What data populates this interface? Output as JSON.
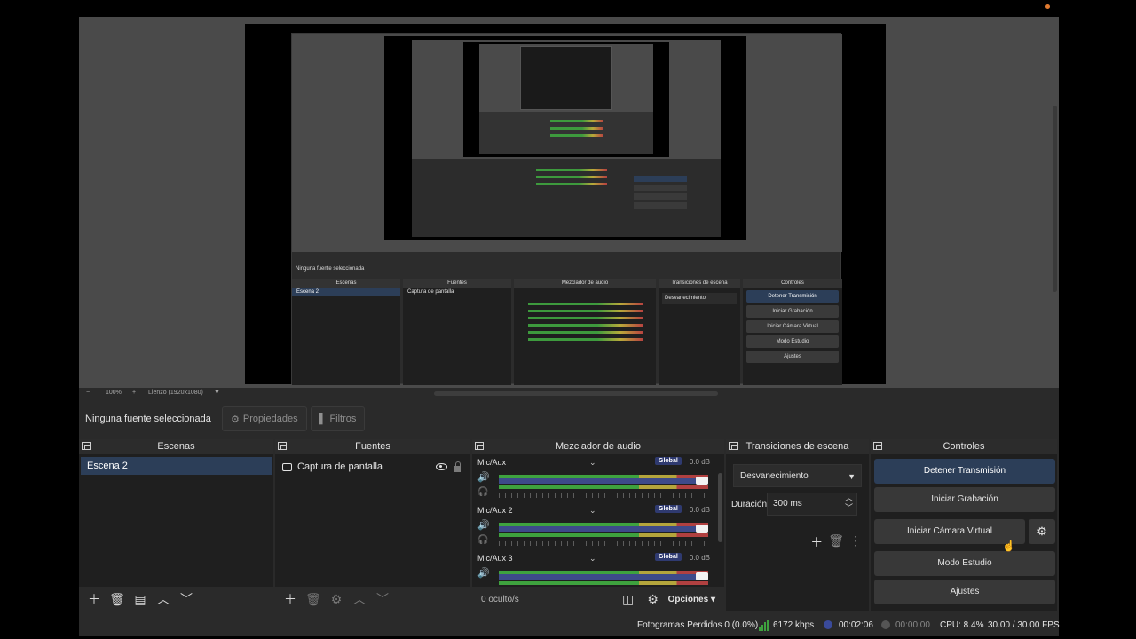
{
  "source_bar": {
    "no_source": "Ninguna fuente seleccionada",
    "properties": "Propiedades",
    "filters": "Filtros"
  },
  "zoom": {
    "minus": "−",
    "level": "100%",
    "plus": "+",
    "canvas": "Lienzo (1920x1080)"
  },
  "docks": {
    "scenes": {
      "title": "Escenas",
      "items": [
        "Escena 2"
      ]
    },
    "sources": {
      "title": "Fuentes",
      "items": [
        "Captura de pantalla"
      ]
    },
    "mixer": {
      "title": "Mezclador de audio",
      "channels": [
        {
          "name": "Mic/Aux",
          "tag": "Global",
          "db": "0.0 dB"
        },
        {
          "name": "Mic/Aux 2",
          "tag": "Global",
          "db": "0.0 dB"
        },
        {
          "name": "Mic/Aux 3",
          "tag": "Global",
          "db": "0.0 dB"
        }
      ],
      "hidden": "0 oculto/s",
      "options": "Opciones"
    },
    "transitions": {
      "title": "Transiciones de escena",
      "type": "Desvanecimiento",
      "duration_label": "Duración",
      "duration_value": "300 ms"
    },
    "controls": {
      "title": "Controles",
      "stop_stream": "Detener Transmisión",
      "start_recording": "Iniciar Grabación",
      "start_virtual_cam": "Iniciar Cámara Virtual",
      "studio_mode": "Modo Estudio",
      "settings": "Ajustes"
    }
  },
  "status": {
    "dropped": "Fotogramas Perdidos 0 (0.0%)",
    "bitrate": "6172 kbps",
    "stream_time": "00:02:06",
    "rec_time": "00:00:00",
    "cpu": "CPU: 8.4%",
    "fps": "30.00 / 30.00 FPS"
  },
  "colors": {
    "accent": "#2c3e58",
    "dock_bg": "#1f1f1f",
    "global_tag": "#2f3a70"
  }
}
